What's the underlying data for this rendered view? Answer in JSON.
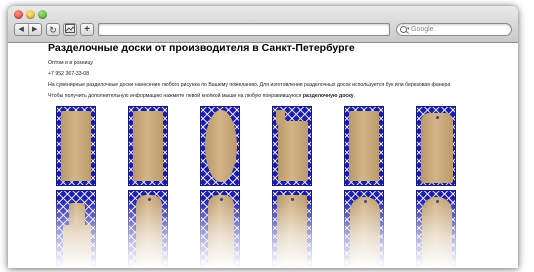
{
  "browser": {
    "nav_back_glyph": "◀",
    "nav_forward_glyph": "▶",
    "reload_glyph": "↻",
    "add_glyph": "+",
    "url": "",
    "search_placeholder": "Google"
  },
  "page": {
    "title": "Разделочные доски от производителя в Санкт-Петербурге",
    "line1": "Оптом и в розницу",
    "phone": "+7 952 367-33-08",
    "description": "На сувенирные разделочные доски нанесение любого рисунка по Вашему пожеланию. Для изготовления разделочных досок используется бук или березовая фанера",
    "instruction_prefix": "Чтобы получить дополнительную информацию нажмите левой кнопкой мыши на любую понравившуюся ",
    "instruction_bold": "разделочную доску",
    "instruction_suffix": "."
  },
  "gallery": {
    "items": [
      {
        "name": "board-1",
        "shape": "rect"
      },
      {
        "name": "board-2",
        "shape": "rect"
      },
      {
        "name": "board-3",
        "shape": "oval"
      },
      {
        "name": "board-4",
        "shape": "flag"
      },
      {
        "name": "board-5",
        "shape": "rect"
      },
      {
        "name": "board-6",
        "shape": "round"
      },
      {
        "name": "board-7",
        "shape": "handle"
      },
      {
        "name": "board-8",
        "shape": "paddle"
      },
      {
        "name": "board-9",
        "shape": "paddle"
      },
      {
        "name": "board-10",
        "shape": "rect"
      },
      {
        "name": "board-11",
        "shape": "gothic"
      },
      {
        "name": "board-12",
        "shape": "gothic"
      }
    ]
  },
  "colors": {
    "tile_background": "#1c1cb4",
    "wood": "#c9aa7c"
  }
}
